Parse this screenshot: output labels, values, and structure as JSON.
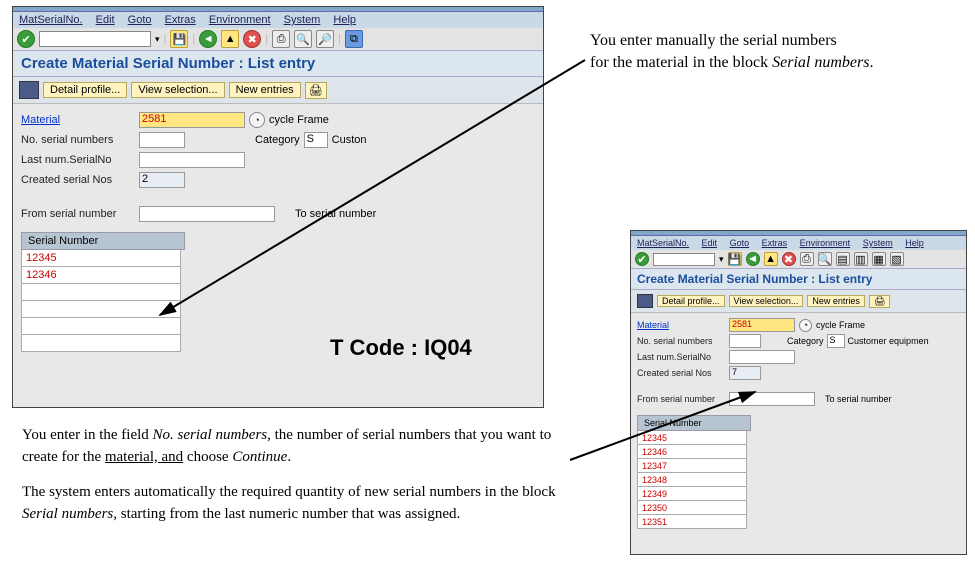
{
  "menu": {
    "m0": "MatSerialNo.",
    "m1": "Edit",
    "m2": "Goto",
    "m3": "Extras",
    "m4": "Environment",
    "m5": "System",
    "m6": "Help"
  },
  "title": "Create Material Serial Number : List entry",
  "buttons": {
    "detail": "Detail profile...",
    "viewsel": "View selection...",
    "newent": "New entries"
  },
  "labels": {
    "material": "Material",
    "nserial": "No. serial numbers",
    "lastnum": "Last num.SerialNo",
    "created": "Created serial Nos",
    "from": "From serial number",
    "to": "To serial number",
    "sn": "Serial Number"
  },
  "win1": {
    "material": "2581",
    "material_desc": "cycle Frame",
    "created": "2",
    "cat_lab": "Category",
    "cat_val": "S",
    "cat_desc": "Custon",
    "sn": [
      "12345",
      "12346",
      "",
      "",
      "",
      ""
    ]
  },
  "win2": {
    "material": "2581",
    "material_desc": "cycle Frame",
    "created": "7",
    "cat_lab": "Category",
    "cat_val": "S",
    "cat_desc": "Customer equipmen",
    "sn": [
      "12345",
      "12346",
      "12347",
      "12348",
      "12349",
      "12350",
      "12351"
    ]
  },
  "annot1a": "You enter manually the serial numbers",
  "annot1b": "for the material in the block ",
  "annot1c": "Serial numbers",
  "tcode": "T Code : IQ04",
  "para1a": "You enter in the field ",
  "para1b": "No. serial numbers",
  "para1c": ", the number of serial numbers that you want to create for the ",
  "para1d": "material, and",
  "para1e": " choose ",
  "para1f": "Continue",
  "para1g": ".",
  "para2": "The system enters automatically the required quantity of new serial numbers in the block ",
  "para2b": "Serial numbers",
  "para2c": ", starting from the last numeric number that was assigned."
}
